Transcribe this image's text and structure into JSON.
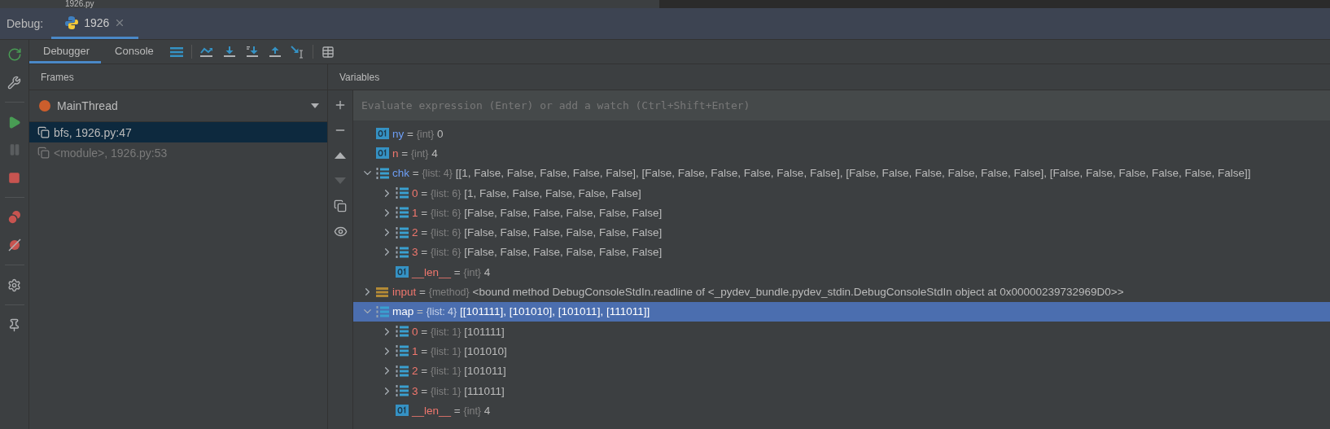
{
  "editor_tab": {
    "label": "1926.py"
  },
  "debug_bar": {
    "title": "Debug:",
    "tabs": [
      {
        "label": "1926",
        "selected": true
      }
    ]
  },
  "toolbar_tabs": [
    {
      "label": "Debugger",
      "selected": true
    },
    {
      "label": "Console",
      "selected": false
    }
  ],
  "frames": {
    "header": "Frames",
    "thread": {
      "name": "MainThread"
    },
    "items": [
      {
        "label": "bfs, 1926.py:47",
        "selected": true,
        "dimmed": false
      },
      {
        "label": "<module>, 1926.py:53",
        "selected": false,
        "dimmed": true
      }
    ]
  },
  "variables": {
    "header": "Variables",
    "placeholder": "Evaluate expression (Enter) or add a watch (Ctrl+Shift+Enter)",
    "items": [
      {
        "name": "ny",
        "op": "=",
        "type": "{int}",
        "value": "0",
        "kind": "int",
        "changed": true,
        "selected": false
      },
      {
        "name": "n",
        "op": "=",
        "type": "{int}",
        "value": "4",
        "kind": "int",
        "changed": false,
        "selected": false
      },
      {
        "name": "chk",
        "op": "=",
        "type": "{list: 4}",
        "value": "[[1, False, False, False, False, False], [False, False, False, False, False, False], [False, False, False, False, False, False], [False, False, False, False, False, False]]",
        "kind": "list",
        "changed": true,
        "selected": false,
        "expanded": true,
        "children": [
          {
            "name": "0",
            "op": "=",
            "type": "{list: 6}",
            "value": "[1, False, False, False, False, False]",
            "kind": "list",
            "changed": false,
            "selected": false,
            "expanded": false
          },
          {
            "name": "1",
            "op": "=",
            "type": "{list: 6}",
            "value": "[False, False, False, False, False, False]",
            "kind": "list",
            "changed": false,
            "selected": false,
            "expanded": false
          },
          {
            "name": "2",
            "op": "=",
            "type": "{list: 6}",
            "value": "[False, False, False, False, False, False]",
            "kind": "list",
            "changed": false,
            "selected": false,
            "expanded": false
          },
          {
            "name": "3",
            "op": "=",
            "type": "{list: 6}",
            "value": "[False, False, False, False, False, False]",
            "kind": "list",
            "changed": false,
            "selected": false,
            "expanded": false
          },
          {
            "name": "__len__",
            "op": "=",
            "type": "{int}",
            "value": "4",
            "kind": "int",
            "changed": false,
            "selected": false
          }
        ]
      },
      {
        "name": "input",
        "op": "=",
        "type": "{method}",
        "value": "<bound method DebugConsoleStdIn.readline of <_pydev_bundle.pydev_stdin.DebugConsoleStdIn object at 0x00000239732969D0>>",
        "kind": "method",
        "changed": false,
        "selected": false,
        "expanded": false
      },
      {
        "name": "map",
        "op": "=",
        "type": "{list: 4}",
        "value": "[[101111], [101010], [101011], [111011]]",
        "kind": "list",
        "selected": true,
        "expanded": true,
        "children": [
          {
            "name": "0",
            "op": "=",
            "type": "{list: 1}",
            "value": "[101111]",
            "kind": "list",
            "changed": false,
            "selected": false,
            "expanded": false
          },
          {
            "name": "1",
            "op": "=",
            "type": "{list: 1}",
            "value": "[101010]",
            "kind": "list",
            "changed": false,
            "selected": false,
            "expanded": false
          },
          {
            "name": "2",
            "op": "=",
            "type": "{list: 1}",
            "value": "[101011]",
            "kind": "list",
            "changed": false,
            "selected": false,
            "expanded": false
          },
          {
            "name": "3",
            "op": "=",
            "type": "{list: 1}",
            "value": "[111011]",
            "kind": "list",
            "changed": false,
            "selected": false,
            "expanded": false
          },
          {
            "name": "__len__",
            "op": "=",
            "type": "{int}",
            "value": "4",
            "kind": "int",
            "changed": false,
            "selected": false
          }
        ]
      }
    ]
  }
}
